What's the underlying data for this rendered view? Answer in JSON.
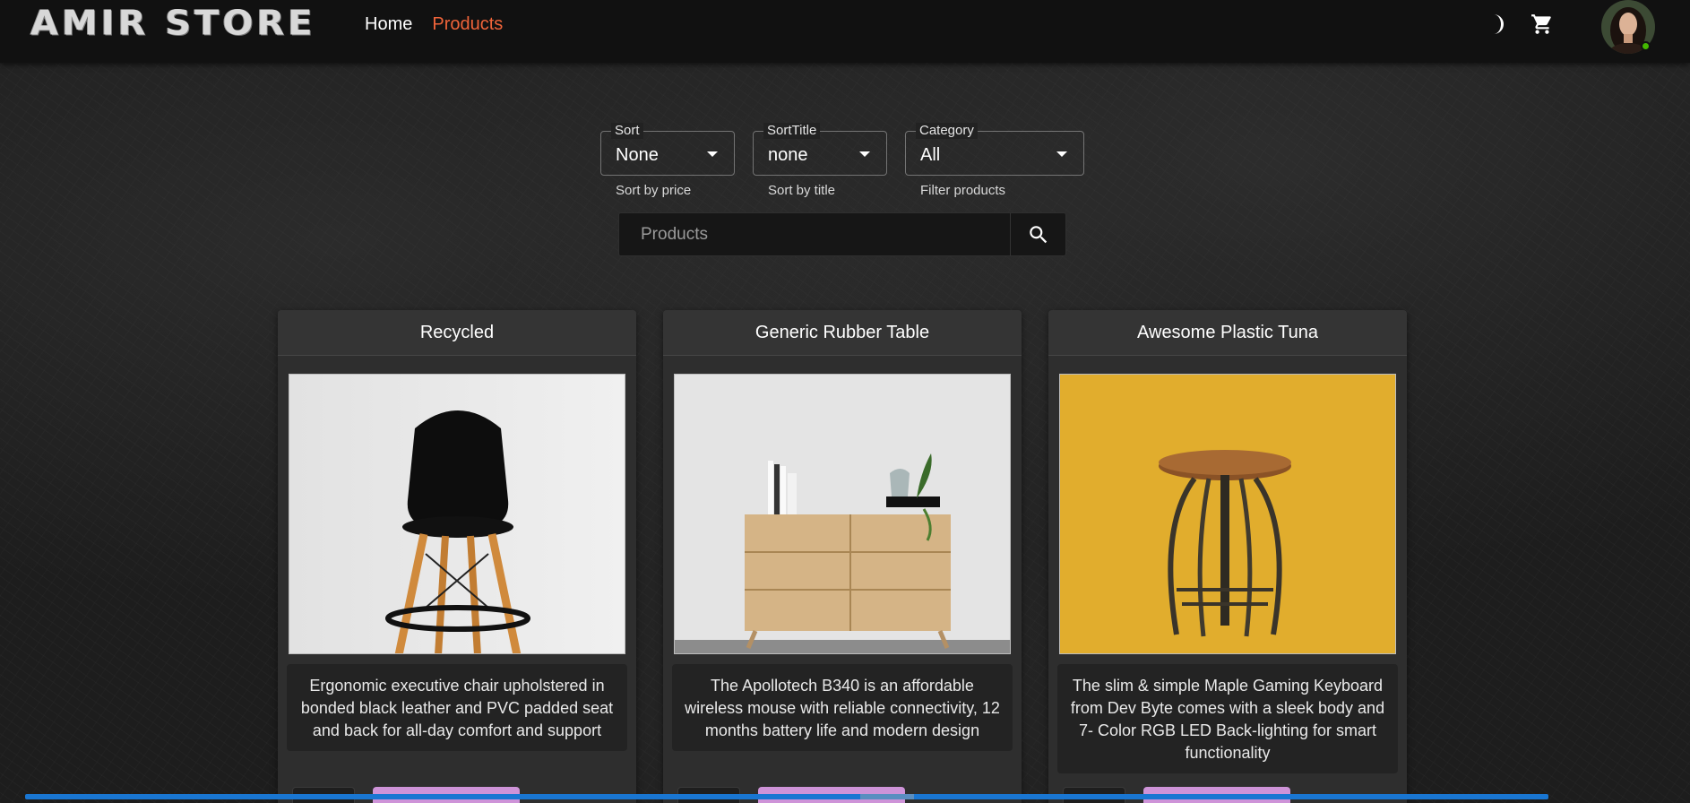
{
  "header": {
    "logo": "AMIR STORE",
    "nav": [
      {
        "label": "Home"
      },
      {
        "label": "Products"
      }
    ],
    "icons": [
      "moon-icon",
      "shopping-cart-icon"
    ]
  },
  "filters": {
    "sort": {
      "legend": "Sort",
      "value": "None",
      "helper": "Sort by price"
    },
    "sort_title": {
      "legend": "SortTitle",
      "value": "none",
      "helper": "Sort by title"
    },
    "category": {
      "legend": "Category",
      "value": "All",
      "helper": "Filter products"
    }
  },
  "search": {
    "placeholder": "Products"
  },
  "products": [
    {
      "title": "Recycled",
      "description": "Ergonomic executive chair upholstered in bonded black leather and PVC padded seat and back for all-day comfort and support"
    },
    {
      "title": "Generic Rubber Table",
      "description": "The Apollotech B340 is an affordable wireless mouse with reliable connectivity, 12 months battery life and modern design"
    },
    {
      "title": "Awesome Plastic Tuna",
      "description": "The slim & simple Maple Gaming Keyboard from Dev Byte comes with a sleek body and 7- Color RGB LED Back-lighting for smart functionality"
    }
  ],
  "colors": {
    "accent": "#f0643a",
    "cart_button": "#ce93d8",
    "progress": "#1976d2"
  }
}
